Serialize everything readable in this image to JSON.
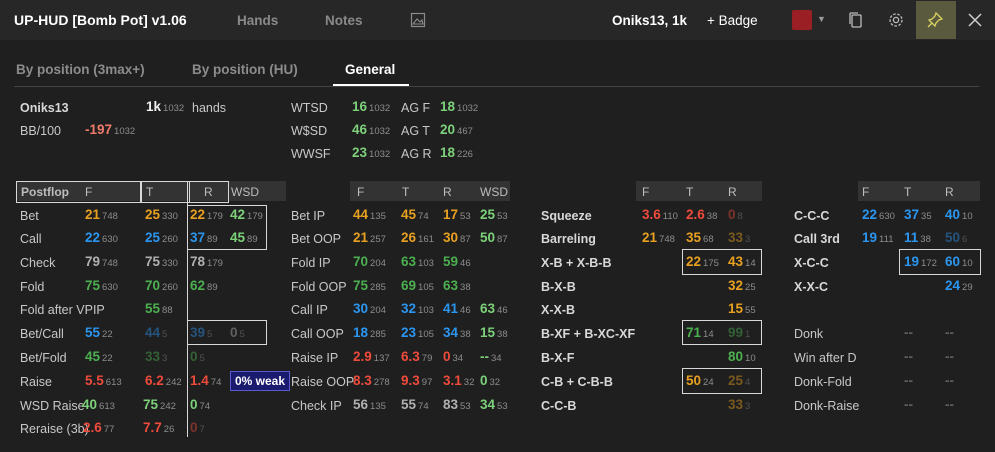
{
  "window": {
    "title": "UP-HUD [Bomb Pot] v1.06",
    "tabs": [
      "Hands",
      "Notes"
    ],
    "user": "Oniks13, 1k",
    "badge_button": "+ Badge",
    "swatch_color": "#9a1f24"
  },
  "subtabs": [
    "By position (3max+)",
    "By position (HU)",
    "General"
  ],
  "active_subtab": "General",
  "player": {
    "name": "Oniks13",
    "hands_val": "1k",
    "hands_n": "1032",
    "hands_label": "hands",
    "bb100_label": "BB/100",
    "bb100_val": "-197",
    "bb100_n": "1032"
  },
  "summary": [
    {
      "label": "WTSD",
      "val": "16",
      "n": "1032",
      "label2": "AG F",
      "val2": "18",
      "n2": "1032"
    },
    {
      "label": "W$SD",
      "val": "46",
      "n": "1032",
      "label2": "AG T",
      "val2": "20",
      "n2": "467"
    },
    {
      "label": "WWSF",
      "val": "23",
      "n": "1032",
      "label2": "AG R",
      "val2": "18",
      "n2": "226"
    }
  ],
  "postflop": {
    "headers": [
      "Postflop",
      "F",
      "T",
      "R",
      "WSD"
    ],
    "rows": [
      {
        "label": "Bet",
        "cells": [
          [
            "21",
            "748",
            "c-yellow"
          ],
          [
            "25",
            "330",
            "c-yellow"
          ],
          [
            "22",
            "179",
            "c-yellow"
          ],
          [
            "42",
            "179",
            "c-green"
          ]
        ]
      },
      {
        "label": "Call",
        "cells": [
          [
            "22",
            "630",
            "c-blue"
          ],
          [
            "25",
            "260",
            "c-blue"
          ],
          [
            "37",
            "89",
            "c-blue"
          ],
          [
            "45",
            "89",
            "c-green"
          ]
        ]
      },
      {
        "label": "Check",
        "cells": [
          [
            "79",
            "748",
            "c-gray"
          ],
          [
            "75",
            "330",
            "c-gray"
          ],
          [
            "78",
            "179",
            "c-gray"
          ]
        ]
      },
      {
        "label": "Fold",
        "cells": [
          [
            "75",
            "630",
            "c-dgreen"
          ],
          [
            "70",
            "260",
            "c-dgreen"
          ],
          [
            "62",
            "89",
            "c-dgreen"
          ]
        ]
      },
      {
        "label": "Fold after VPIP",
        "cells": [
          [
            "55",
            "88",
            "c-dgreen"
          ]
        ]
      },
      {
        "label": "Bet/Call",
        "cells": [
          [
            "55",
            "22",
            "c-blue"
          ],
          [
            "44",
            "5",
            "c-blue dim"
          ],
          [
            "39",
            "5",
            "c-blue dim"
          ],
          [
            "0",
            "5",
            "c-gray dim"
          ]
        ]
      },
      {
        "label": "Bet/Fold",
        "cells": [
          [
            "45",
            "22",
            "c-dgreen"
          ],
          [
            "33",
            "3",
            "c-dgreen dim"
          ],
          [
            "0",
            "5",
            "c-dgreen dim"
          ]
        ]
      },
      {
        "label": "Raise",
        "cells": [
          [
            "5.5",
            "613",
            "c-red"
          ],
          [
            "6.2",
            "242",
            "c-red"
          ],
          [
            "1.4",
            "74",
            "c-red"
          ]
        ]
      },
      {
        "label": "WSD Raise",
        "cells": [
          [
            "40",
            "613",
            "c-green"
          ],
          [
            "75",
            "242",
            "c-green"
          ],
          [
            "0",
            "74",
            "c-green"
          ]
        ]
      },
      {
        "label": "Reraise (3b)",
        "cells": [
          [
            "2.6",
            "77",
            "c-red"
          ],
          [
            "7.7",
            "26",
            "c-red"
          ],
          [
            "0",
            "7",
            "c-red dim"
          ]
        ]
      }
    ],
    "weak_badge": "0% weak"
  },
  "betip": {
    "headers": [
      "F",
      "T",
      "R",
      "WSD"
    ],
    "rows": [
      {
        "label": "Bet IP",
        "cells": [
          [
            "44",
            "135",
            "c-yellow"
          ],
          [
            "45",
            "74",
            "c-yellow"
          ],
          [
            "17",
            "53",
            "c-yellow"
          ],
          [
            "25",
            "53",
            "c-green"
          ]
        ]
      },
      {
        "label": "Bet OOP",
        "cells": [
          [
            "21",
            "257",
            "c-yellow"
          ],
          [
            "26",
            "161",
            "c-yellow"
          ],
          [
            "30",
            "87",
            "c-yellow"
          ],
          [
            "50",
            "87",
            "c-green"
          ]
        ]
      },
      {
        "label": "Fold IP",
        "cells": [
          [
            "70",
            "204",
            "c-dgreen"
          ],
          [
            "63",
            "103",
            "c-dgreen"
          ],
          [
            "59",
            "46",
            "c-dgreen"
          ]
        ]
      },
      {
        "label": "Fold OOP",
        "cells": [
          [
            "75",
            "285",
            "c-dgreen"
          ],
          [
            "69",
            "105",
            "c-dgreen"
          ],
          [
            "63",
            "38",
            "c-dgreen"
          ]
        ]
      },
      {
        "label": "Call IP",
        "cells": [
          [
            "30",
            "204",
            "c-blue"
          ],
          [
            "32",
            "103",
            "c-blue"
          ],
          [
            "41",
            "46",
            "c-blue"
          ],
          [
            "63",
            "46",
            "c-green"
          ]
        ]
      },
      {
        "label": "Call OOP",
        "cells": [
          [
            "18",
            "285",
            "c-blue"
          ],
          [
            "23",
            "105",
            "c-blue"
          ],
          [
            "34",
            "38",
            "c-blue"
          ],
          [
            "15",
            "38",
            "c-green"
          ]
        ]
      },
      {
        "label": "Raise IP",
        "cells": [
          [
            "2.9",
            "137",
            "c-red"
          ],
          [
            "6.3",
            "79",
            "c-red"
          ],
          [
            "0",
            "34",
            "c-red"
          ],
          [
            "--",
            "34",
            "c-green"
          ]
        ]
      },
      {
        "label": "Raise OOP",
        "cells": [
          [
            "8.3",
            "278",
            "c-red"
          ],
          [
            "9.3",
            "97",
            "c-red"
          ],
          [
            "3.1",
            "32",
            "c-red"
          ],
          [
            "0",
            "32",
            "c-green"
          ]
        ]
      },
      {
        "label": "Check  IP",
        "cells": [
          [
            "56",
            "135",
            "c-gray"
          ],
          [
            "55",
            "74",
            "c-gray"
          ],
          [
            "83",
            "53",
            "c-gray"
          ],
          [
            "34",
            "53",
            "c-green"
          ]
        ]
      }
    ]
  },
  "squeeze": {
    "headers": [
      "F",
      "T",
      "R"
    ],
    "rows": [
      {
        "label": "Squeeze",
        "cells": [
          [
            "3.6",
            "110",
            "c-red"
          ],
          [
            "2.6",
            "38",
            "c-red"
          ],
          [
            "0",
            "8",
            "c-red dim"
          ]
        ]
      },
      {
        "label": "Barreling",
        "cells": [
          [
            "21",
            "748",
            "c-yellow"
          ],
          [
            "35",
            "68",
            "c-yellow"
          ],
          [
            "33",
            "3",
            "c-yellow dim"
          ]
        ]
      },
      {
        "label": "X-B + X-B-B",
        "cells": [
          null,
          [
            "22",
            "175",
            "c-yellow"
          ],
          [
            "43",
            "14",
            "c-yellow"
          ]
        ]
      },
      {
        "label": "B-X-B",
        "cells": [
          null,
          null,
          [
            "32",
            "25",
            "c-yellow"
          ]
        ]
      },
      {
        "label": "X-X-B",
        "cells": [
          null,
          null,
          [
            "15",
            "55",
            "c-yellow"
          ]
        ]
      },
      {
        "label": "B-XF + B-XC-XF",
        "cells": [
          null,
          [
            "71",
            "14",
            "c-dgreen"
          ],
          [
            "99",
            "1",
            "c-dgreen dim"
          ]
        ]
      },
      {
        "label": "B-X-F",
        "cells": [
          null,
          null,
          [
            "80",
            "10",
            "c-dgreen"
          ]
        ]
      },
      {
        "label": "C-B + C-B-B",
        "cells": [
          null,
          [
            "50",
            "24",
            "c-yellow"
          ],
          [
            "25",
            "4",
            "c-yellow dim"
          ]
        ]
      },
      {
        "label": "C-C-B",
        "cells": [
          null,
          null,
          [
            "33",
            "3",
            "c-yellow dim"
          ]
        ]
      }
    ]
  },
  "ccc": {
    "headers": [
      "F",
      "T",
      "R"
    ],
    "rows": [
      {
        "label": "C-C-C",
        "cells": [
          [
            "22",
            "630",
            "c-blue"
          ],
          [
            "37",
            "35",
            "c-blue"
          ],
          [
            "40",
            "10",
            "c-blue"
          ]
        ]
      },
      {
        "label": "Call 3rd",
        "cells": [
          [
            "19",
            "111",
            "c-blue"
          ],
          [
            "11",
            "38",
            "c-blue"
          ],
          [
            "50",
            "6",
            "c-blue dim"
          ]
        ]
      },
      {
        "label": "X-C-C",
        "cells": [
          null,
          [
            "19",
            "172",
            "c-blue"
          ],
          [
            "60",
            "10",
            "c-blue"
          ]
        ]
      },
      {
        "label": "X-X-C",
        "cells": [
          null,
          null,
          [
            "24",
            "29",
            "c-blue"
          ]
        ]
      },
      {
        "label": "",
        "cells": []
      },
      {
        "label": "Donk",
        "cells": [
          null,
          [
            "--",
            "",
            "c-gray dim"
          ],
          [
            "--",
            "",
            "c-gray dim"
          ]
        ]
      },
      {
        "label": "Win after D",
        "cells": [
          null,
          [
            "--",
            "",
            "c-gray dim"
          ],
          [
            "--",
            "",
            "c-gray dim"
          ]
        ]
      },
      {
        "label": "Donk-Fold",
        "cells": [
          null,
          [
            "--",
            "",
            "c-gray dim"
          ],
          [
            "--",
            "",
            "c-gray dim"
          ]
        ]
      },
      {
        "label": "Donk-Raise",
        "cells": [
          null,
          [
            "--",
            "",
            "c-gray dim"
          ],
          [
            "--",
            "",
            "c-gray dim"
          ]
        ]
      }
    ]
  }
}
